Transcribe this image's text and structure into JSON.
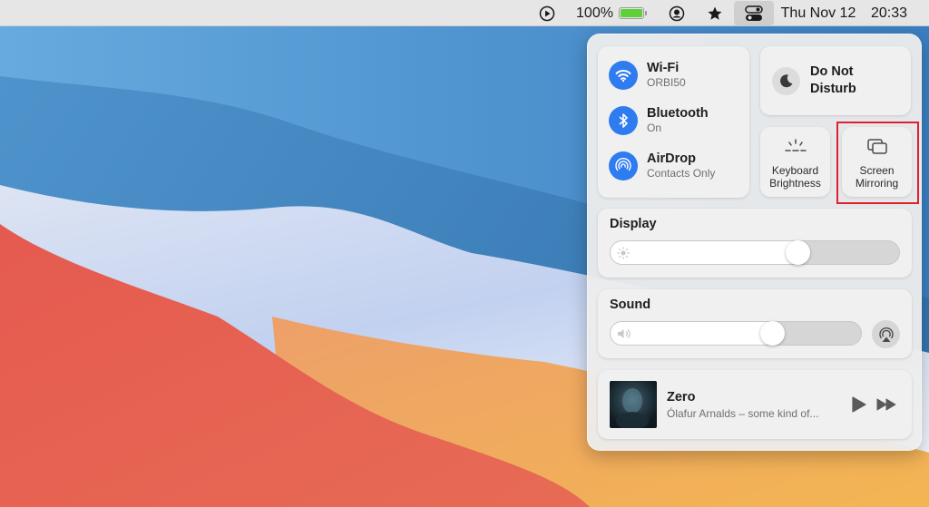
{
  "menubar": {
    "battery_percent": "100%",
    "battery_level": 1.0,
    "date": "Thu Nov 12",
    "time": "20:33",
    "icons": [
      "play-circle-icon",
      "battery-icon",
      "user-circle-icon",
      "star-icon",
      "control-center-icon"
    ]
  },
  "control_center": {
    "network": [
      {
        "title": "Wi-Fi",
        "subtitle": "ORBI50",
        "icon": "wifi-icon"
      },
      {
        "title": "Bluetooth",
        "subtitle": "On",
        "icon": "bluetooth-icon"
      },
      {
        "title": "AirDrop",
        "subtitle": "Contacts Only",
        "icon": "airdrop-icon"
      }
    ],
    "dnd": {
      "line1": "Do Not",
      "line2": "Disturb",
      "icon": "moon-icon"
    },
    "keyboard_brightness": {
      "line1": "Keyboard",
      "line2": "Brightness",
      "icon": "keyboard-brightness-icon"
    },
    "screen_mirroring": {
      "line1": "Screen",
      "line2": "Mirroring",
      "icon": "screen-mirroring-icon",
      "highlighted": true
    },
    "display": {
      "title": "Display",
      "level": 0.65
    },
    "sound": {
      "title": "Sound",
      "level": 0.65
    },
    "now_playing": {
      "title": "Zero",
      "subtitle": "Ólafur Arnalds – some kind of..."
    }
  },
  "colors": {
    "accent": "#2f7bf0",
    "highlight_box": "#e0202a",
    "battery_fill": "#5fcf3a"
  }
}
